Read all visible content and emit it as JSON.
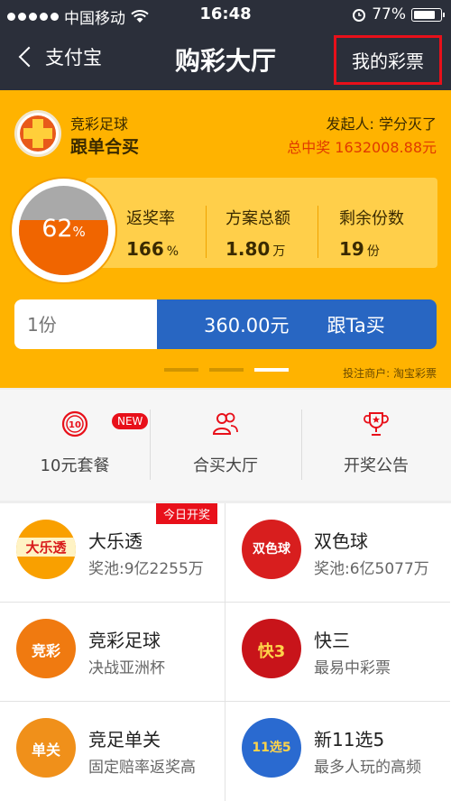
{
  "status_bar": {
    "carrier": "中国移动",
    "time": "16:48",
    "battery": "77%"
  },
  "nav": {
    "back_label": "支付宝",
    "title": "购彩大厅",
    "right_button": "我的彩票"
  },
  "banner": {
    "lottery_type": "竞彩足球",
    "subtitle": "跟单合买",
    "initiator": "发起人: 学分灭了",
    "total_win": "总中奖 1632008.88元",
    "progress_value": "62",
    "progress_unit": "%",
    "progress_fraction": 0.62,
    "stats": [
      {
        "label": "返奖率",
        "value": "166",
        "unit": "%"
      },
      {
        "label": "方案总额",
        "value": "1.80",
        "unit": "万"
      },
      {
        "label": "剩余份数",
        "value": "19",
        "unit": "份"
      }
    ],
    "quantity_placeholder": "1份",
    "amount": "360.00元",
    "buy_label": "跟Ta买",
    "merchant": "投注商户: 淘宝彩票"
  },
  "quick_menu": [
    {
      "label": "10元套餐",
      "icon": "ten-yuan-icon",
      "badge": "NEW"
    },
    {
      "label": "合买大厅",
      "icon": "group-icon"
    },
    {
      "label": "开奖公告",
      "icon": "trophy-icon"
    }
  ],
  "games": [
    {
      "name": "大乐透",
      "desc": "奖池:9亿2255万",
      "icon": "daletou-icon",
      "icon_text": "大乐透",
      "badge": "今日开奖"
    },
    {
      "name": "双色球",
      "desc": "奖池:6亿5077万",
      "icon": "shuangseqiu-icon",
      "icon_text": "双色球"
    },
    {
      "name": "竞彩足球",
      "desc": "决战亚洲杯",
      "icon": "jingcai-football-icon",
      "icon_text": "竞彩"
    },
    {
      "name": "快三",
      "desc": "最易中彩票",
      "icon": "kuaisan-icon",
      "icon_text": "快3"
    },
    {
      "name": "竞足单关",
      "desc": "固定赔率返奖高",
      "icon": "single-match-icon",
      "icon_text": "单关"
    },
    {
      "name": "新11选5",
      "desc": "最多人玩的高频",
      "icon": "eleven-five-icon",
      "icon_text": "11选5"
    }
  ],
  "colors": {
    "nav_bg": "#2b2f3a",
    "banner_bg": "#ffb300",
    "buy_button": "#2866c2",
    "accent_red": "#e8101a"
  }
}
